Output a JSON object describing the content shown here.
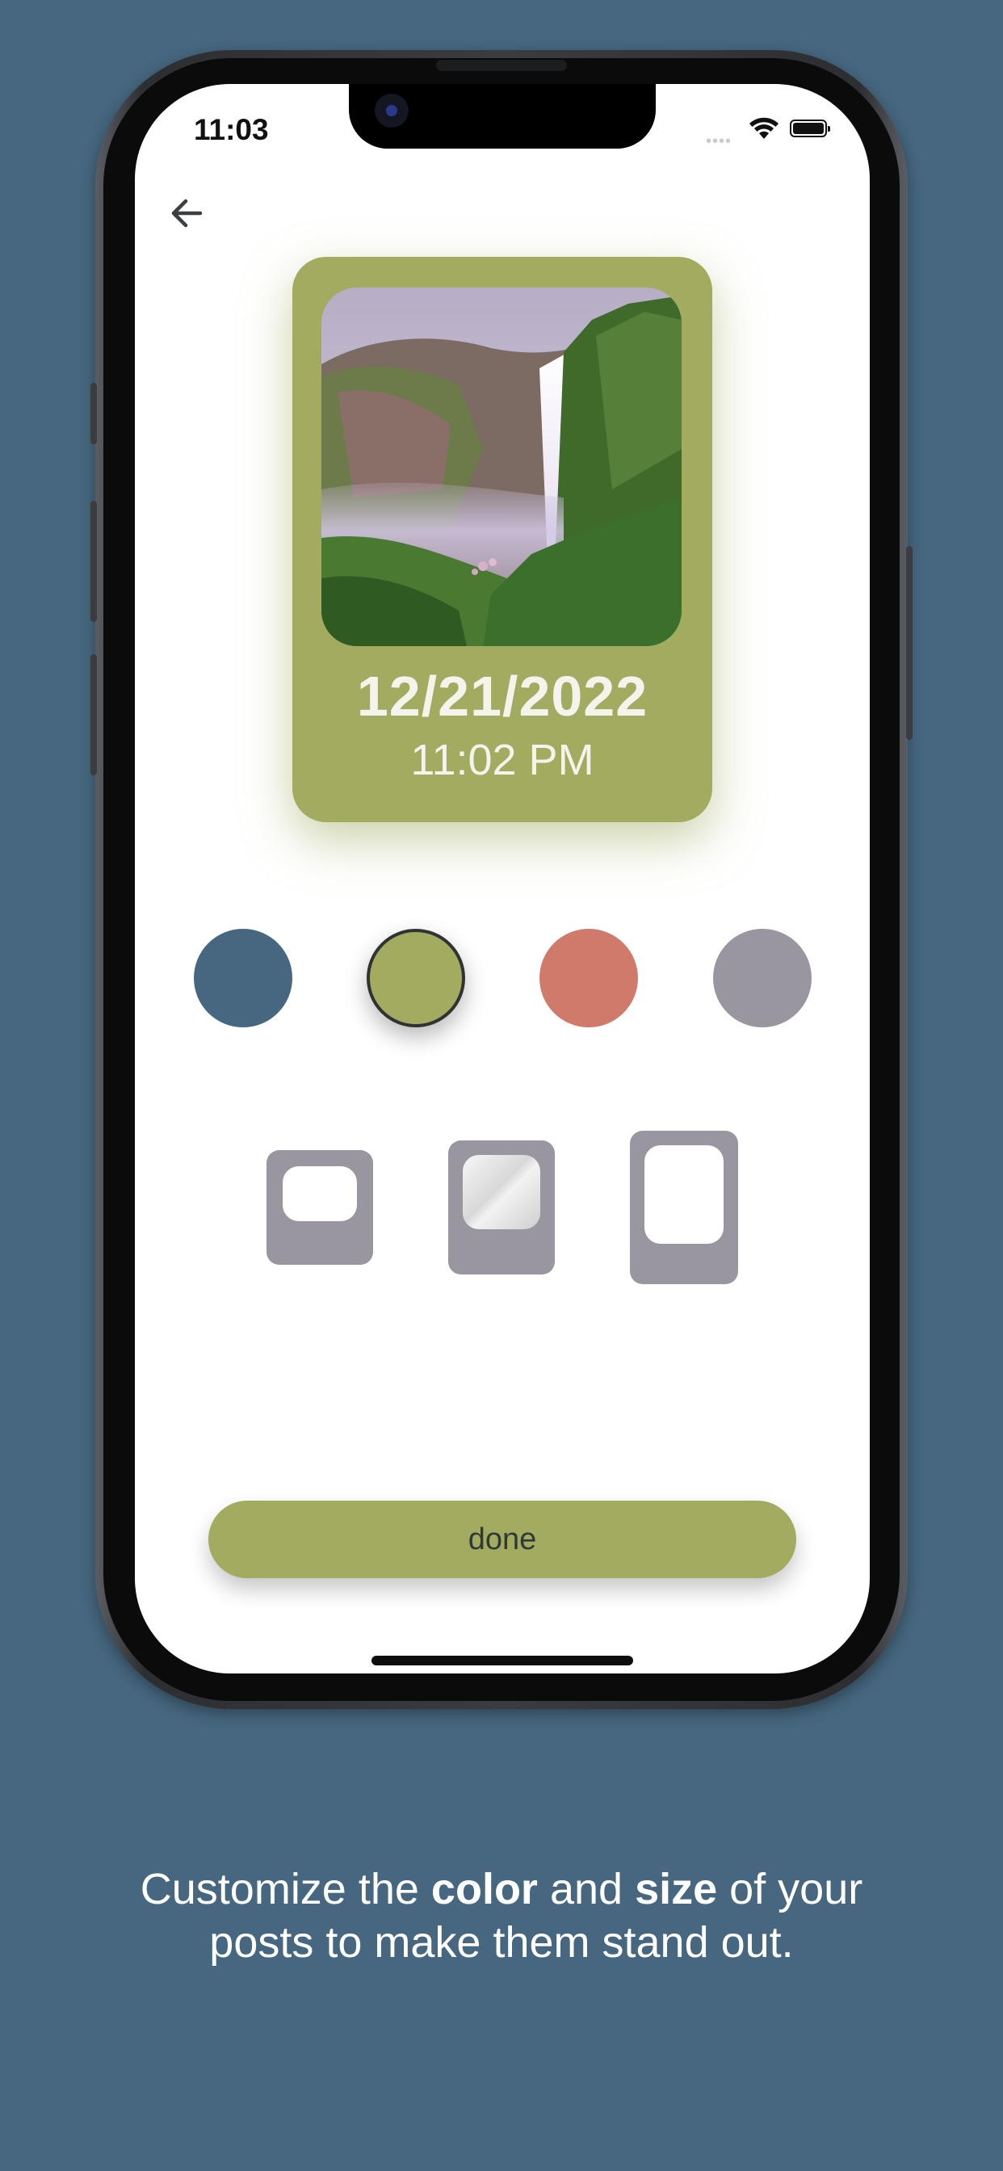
{
  "status_bar": {
    "time": "11:03"
  },
  "navigation": {
    "back_icon": "arrow-left-icon"
  },
  "post_preview": {
    "date": "12/21/2022",
    "time": "11:02 PM",
    "card_color": "#a3ab60",
    "photo_subject": "waterfall landscape photo"
  },
  "color_options": [
    {
      "name": "blue",
      "color": "#46677f",
      "selected": false
    },
    {
      "name": "olive",
      "color": "#a3ab60",
      "selected": true
    },
    {
      "name": "coral",
      "color": "#d07a6b",
      "selected": false
    },
    {
      "name": "gray",
      "color": "#99969f",
      "selected": false
    }
  ],
  "size_options": [
    {
      "name": "small",
      "icon": "size-small-icon"
    },
    {
      "name": "medium",
      "icon": "size-medium-icon"
    },
    {
      "name": "large",
      "icon": "size-large-icon"
    }
  ],
  "done_button": {
    "label": "done"
  },
  "caption": {
    "part1": "Customize the ",
    "bold1": "color",
    "part2": " and ",
    "bold2": "size",
    "part3": " of your",
    "line2": "posts to make them stand out."
  },
  "colors": {
    "background": "#46677f",
    "accent": "#a3ab60",
    "size_option": "#99969f"
  }
}
